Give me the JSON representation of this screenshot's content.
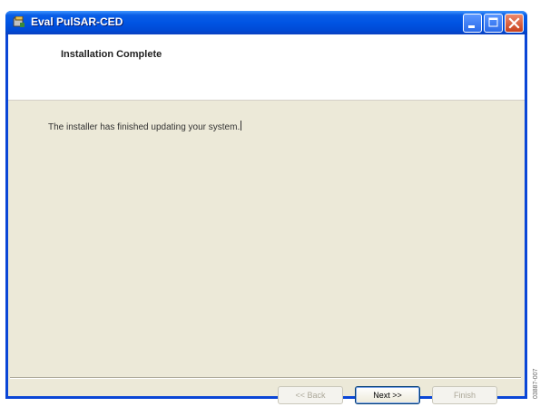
{
  "window": {
    "title": "Eval PulSAR-CED"
  },
  "header": {
    "title": "Installation Complete"
  },
  "body": {
    "message": "The installer has finished updating your system."
  },
  "buttons": {
    "back_label": "<< Back",
    "next_label": "Next >>",
    "finish_label": "Finish"
  },
  "figure_code": "03887-007",
  "colors": {
    "titlebar": "#0054e3",
    "window_background": "#ece9d8",
    "header_background": "#ffffff",
    "close_button": "#c8401c"
  },
  "icons": {
    "app": "installer-app-icon",
    "minimize": "minimize-icon",
    "maximize": "maximize-icon",
    "close": "close-icon"
  }
}
